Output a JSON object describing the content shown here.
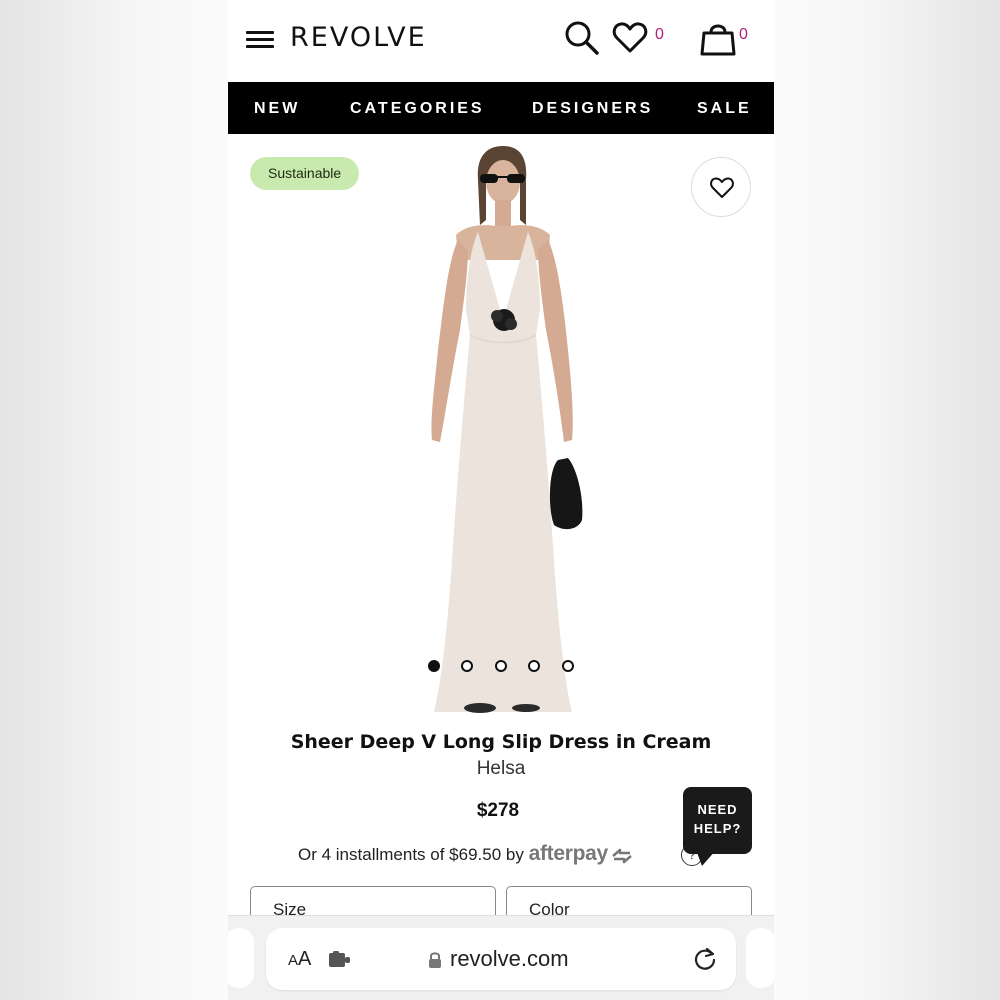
{
  "header": {
    "logo": "REVOLVE",
    "wishlist_count": "0",
    "bag_count": "0"
  },
  "nav": {
    "items": [
      "NEW",
      "CATEGORIES",
      "DESIGNERS",
      "SALE"
    ]
  },
  "product": {
    "badge": "Sustainable",
    "title": "Sheer Deep V Long Slip Dress in Cream",
    "brand": "Helsa",
    "price": "$278",
    "installments_text": "Or 4 installments of $69.50 by ",
    "afterpay_label": "afterpay",
    "image_count": 5,
    "active_image": 0
  },
  "help": {
    "line1": "NEED",
    "line2": "HELP?"
  },
  "selectors": {
    "size_label": "Size",
    "color_label": "Color"
  },
  "browser": {
    "text_size_big": "A",
    "text_size_small": "A",
    "domain": "revolve.com"
  },
  "colors": {
    "accent_count": "#b0207a",
    "badge_bg": "#c9eaae",
    "nav_bg": "#000000"
  }
}
